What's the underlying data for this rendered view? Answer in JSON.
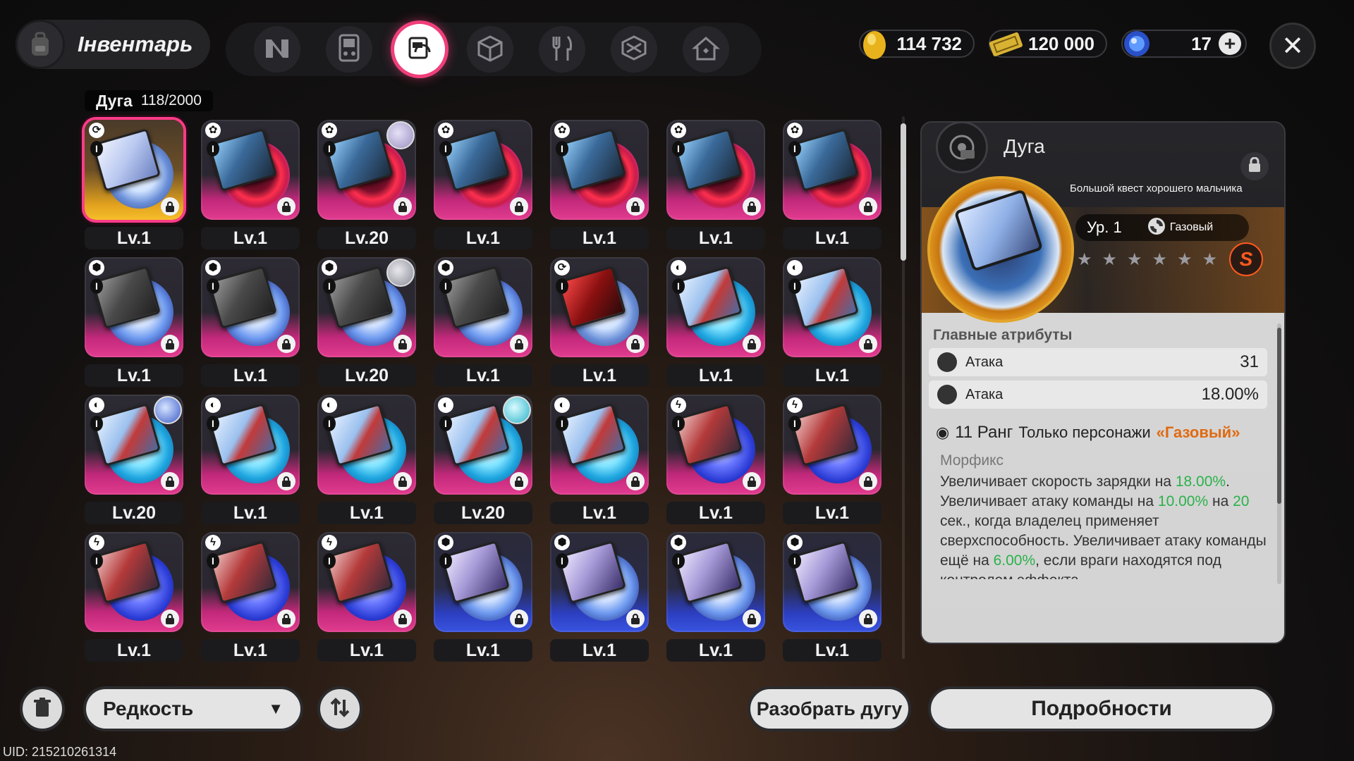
{
  "header": {
    "title": "Інвентарь",
    "nav_tabs": [
      {
        "icon": "n-logo-icon"
      },
      {
        "icon": "handheld-console-icon"
      },
      {
        "icon": "arc-disc-icon",
        "active": true
      },
      {
        "icon": "cube-icon"
      },
      {
        "icon": "fork-knife-icon"
      },
      {
        "icon": "box-open-icon"
      },
      {
        "icon": "house-icon"
      }
    ],
    "currencies": [
      {
        "icon": "gold-egg-icon",
        "value": "114 732"
      },
      {
        "icon": "ticket-icon",
        "value": "120 000"
      },
      {
        "icon": "blue-crystal-icon",
        "value": "17"
      }
    ]
  },
  "grid": {
    "category_label": "Дуга",
    "count": "118/2000",
    "items": [
      {
        "level": "Lv.1",
        "style": "gold",
        "cover": "panda",
        "disc": "white-swirl",
        "attr": "⟳",
        "selected": true
      },
      {
        "level": "Lv.1",
        "style": "pink",
        "cover": "rainman",
        "disc": "red-ring",
        "attr": "✿"
      },
      {
        "level": "Lv.20",
        "style": "pink",
        "cover": "rainman",
        "disc": "red-ring",
        "attr": "✿",
        "avatar": "lavender"
      },
      {
        "level": "Lv.1",
        "style": "pink",
        "cover": "rainman",
        "disc": "red-ring",
        "attr": "✿"
      },
      {
        "level": "Lv.1",
        "style": "pink",
        "cover": "rainman",
        "disc": "red-ring",
        "attr": "✿"
      },
      {
        "level": "Lv.1",
        "style": "pink",
        "cover": "rainman",
        "disc": "red-ring",
        "attr": "✿"
      },
      {
        "level": "Lv.1",
        "style": "pink",
        "cover": "rainman",
        "disc": "red-ring",
        "attr": "✿"
      },
      {
        "level": "Lv.1",
        "style": "pink",
        "cover": "dark",
        "disc": "blue-orb",
        "attr": "⬢"
      },
      {
        "level": "Lv.1",
        "style": "pink",
        "cover": "dark",
        "disc": "blue-orb",
        "attr": "⬢"
      },
      {
        "level": "Lv.20",
        "style": "pink",
        "cover": "dark",
        "disc": "blue-orb",
        "attr": "⬢",
        "avatar": "grey"
      },
      {
        "level": "Lv.1",
        "style": "pink",
        "cover": "dark",
        "disc": "blue-orb",
        "attr": "⬢"
      },
      {
        "level": "Lv.1",
        "style": "pink",
        "cover": "red",
        "disc": "white-swirl",
        "attr": "⟳"
      },
      {
        "level": "Lv.1",
        "style": "pink",
        "cover": "bird",
        "disc": "cyan-wave",
        "attr": "◐"
      },
      {
        "level": "Lv.1",
        "style": "pink",
        "cover": "bird",
        "disc": "cyan-wave",
        "attr": "◐"
      },
      {
        "level": "Lv.20",
        "style": "pink",
        "cover": "bird",
        "disc": "cyan-wave",
        "attr": "◐",
        "avatar": "blue"
      },
      {
        "level": "Lv.1",
        "style": "pink",
        "cover": "bird",
        "disc": "cyan-wave",
        "attr": "◐"
      },
      {
        "level": "Lv.1",
        "style": "pink",
        "cover": "bird",
        "disc": "cyan-wave",
        "attr": "◐"
      },
      {
        "level": "Lv.20",
        "style": "pink",
        "cover": "bird",
        "disc": "cyan-wave",
        "attr": "◐",
        "avatar": "teal"
      },
      {
        "level": "Lv.1",
        "style": "pink",
        "cover": "bird",
        "disc": "cyan-wave",
        "attr": "◐"
      },
      {
        "level": "Lv.1",
        "style": "pink",
        "cover": "red-art",
        "disc": "electric",
        "attr": "ϟ"
      },
      {
        "level": "Lv.1",
        "style": "pink",
        "cover": "red-art",
        "disc": "electric",
        "attr": "ϟ"
      },
      {
        "level": "Lv.1",
        "style": "pink",
        "cover": "red-art",
        "disc": "electric",
        "attr": "ϟ"
      },
      {
        "level": "Lv.1",
        "style": "pink",
        "cover": "red-art",
        "disc": "electric",
        "attr": "ϟ"
      },
      {
        "level": "Lv.1",
        "style": "pink",
        "cover": "red-art",
        "disc": "electric",
        "attr": "ϟ"
      },
      {
        "level": "Lv.1",
        "style": "blue",
        "cover": "violet",
        "disc": "blue-orb",
        "attr": "⬢"
      },
      {
        "level": "Lv.1",
        "style": "blue",
        "cover": "violet",
        "disc": "blue-orb",
        "attr": "⬢"
      },
      {
        "level": "Lv.1",
        "style": "blue",
        "cover": "violet",
        "disc": "blue-orb",
        "attr": "⬢"
      },
      {
        "level": "Lv.1",
        "style": "blue",
        "cover": "violet",
        "disc": "blue-orb",
        "attr": "⬢"
      }
    ]
  },
  "detail": {
    "category": "Дуга",
    "name": "Большой квест хорошего мальчика",
    "level": "Ур. 1",
    "element": "Газовый",
    "stars": [
      "★",
      "★",
      "★",
      "★",
      "★",
      "★"
    ],
    "badge": "S",
    "main_attrs_title": "Главные атрибуты",
    "stats": [
      {
        "name": "Атака",
        "value": "31"
      },
      {
        "name": "Атака",
        "value": "18.00%"
      }
    ],
    "rank": "11 Ранг",
    "restriction": "Только персонажи",
    "restriction_element": "«Газовый»",
    "effect_name": "Морфикс",
    "effect": {
      "p1": "Увеличивает скорость зарядки на ",
      "v1": "18.00%",
      "p2": ". Увеличивает атаку команды на ",
      "v2": "10.00%",
      "p3": " на ",
      "v3": "20",
      "p4": " сек., когда владелец применяет сверхспособность. Увеличивает атаку команды ещё на ",
      "v4": "6.00%",
      "p5": ", если враги находятся под контролем эффекта"
    }
  },
  "bottom": {
    "sort_label": "Редкость",
    "dismantle_label": "Разобрать дугу",
    "details_label": "Подробности",
    "uid": "UID: 215210261314"
  },
  "colors": {
    "accent_pink": "#ef3f7a",
    "rarity_gold": "#f6be2b",
    "rarity_pink": "#e23c8f",
    "rarity_blue": "#3a54e0",
    "element_orange": "#e06a10",
    "value_green": "#2ab24a"
  }
}
